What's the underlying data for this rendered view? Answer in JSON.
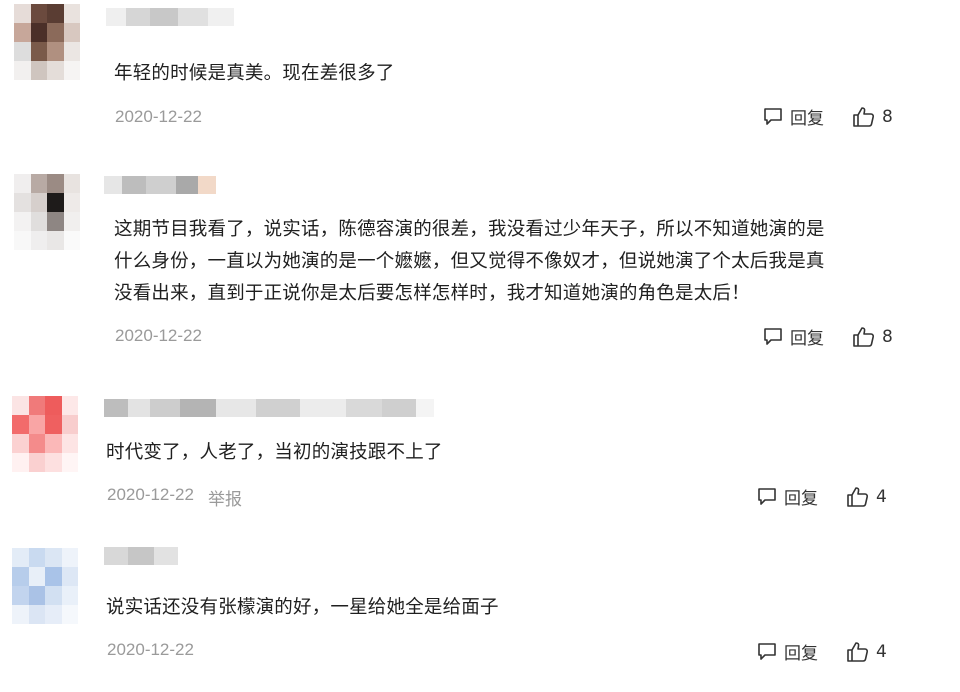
{
  "comments": [
    {
      "text": "年轻的时候是真美。现在差很多了",
      "date": "2020-12-22",
      "reply_label": "回复",
      "likes": "8",
      "report_label": ""
    },
    {
      "text": "这期节目我看了，说实话，陈德容演的很差，我没看过少年天子，所以不知道她演的是\n什么身份，一直以为她演的是一个嬷嬷，但又觉得不像奴才，但说她演了个太后我是真\n没看出来，直到于正说你是太后要怎样怎样时，我才知道她演的角色是太后！",
      "date": "2020-12-22",
      "reply_label": "回复",
      "likes": "8",
      "report_label": ""
    },
    {
      "text": "时代变了，人老了，当初的演技跟不上了",
      "date": "2020-12-22",
      "reply_label": "回复",
      "likes": "4",
      "report_label": "举报"
    },
    {
      "text": "说实话还没有张檬演的好，一星给她全是给面子",
      "date": "2020-12-22",
      "reply_label": "回复",
      "likes": "4",
      "report_label": ""
    }
  ],
  "icons": {
    "reply": "comment-bubble-icon",
    "like": "thumbs-up-icon"
  },
  "colors": {
    "meta": "#9a9a9a",
    "text": "#1f1f1f"
  }
}
